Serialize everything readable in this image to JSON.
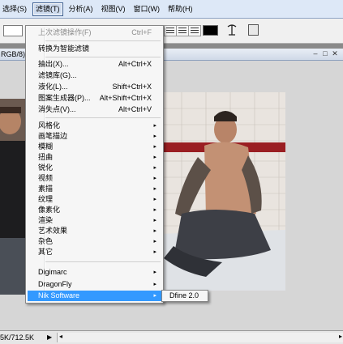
{
  "menubar": {
    "items": [
      {
        "label": "选择(S)"
      },
      {
        "label": "滤镜(T)",
        "active": true
      },
      {
        "label": "分析(A)"
      },
      {
        "label": "视图(V)"
      },
      {
        "label": "窗口(W)"
      },
      {
        "label": "帮助(H)"
      }
    ]
  },
  "document": {
    "title_fragment": "RGB/8)",
    "status_size": "5K/712.5K"
  },
  "filter_menu": {
    "last_filter": {
      "label": "上次滤镜操作(F)",
      "shortcut": "Ctrl+F"
    },
    "smart_filter": {
      "label": "转换为智能滤镜"
    },
    "items_a": [
      {
        "label": "抽出(X)...",
        "shortcut": "Alt+Ctrl+X"
      },
      {
        "label": "滤镜库(G)...",
        "shortcut": ""
      },
      {
        "label": "液化(L)...",
        "shortcut": "Shift+Ctrl+X"
      },
      {
        "label": "图案生成器(P)...",
        "shortcut": "Alt+Shift+Ctrl+X"
      },
      {
        "label": "消失点(V)...",
        "shortcut": "Alt+Ctrl+V"
      }
    ],
    "items_b": [
      {
        "label": "风格化"
      },
      {
        "label": "画笔描边"
      },
      {
        "label": "模糊"
      },
      {
        "label": "扭曲"
      },
      {
        "label": "锐化"
      },
      {
        "label": "视频"
      },
      {
        "label": "素描"
      },
      {
        "label": "纹理"
      },
      {
        "label": "像素化"
      },
      {
        "label": "渲染"
      },
      {
        "label": "艺术效果"
      },
      {
        "label": "杂色"
      },
      {
        "label": "其它"
      }
    ],
    "items_c": [
      {
        "label": "Digimarc"
      },
      {
        "label": "DragonFly"
      },
      {
        "label": "Nik Software",
        "highlighted": true
      }
    ],
    "submenu_arrow": "▸"
  },
  "nik_submenu": {
    "items": [
      {
        "label": "Dfine 2.0"
      }
    ]
  },
  "colors": {
    "highlight": "#3399ff",
    "menubar_bg": "#dde8f7"
  }
}
